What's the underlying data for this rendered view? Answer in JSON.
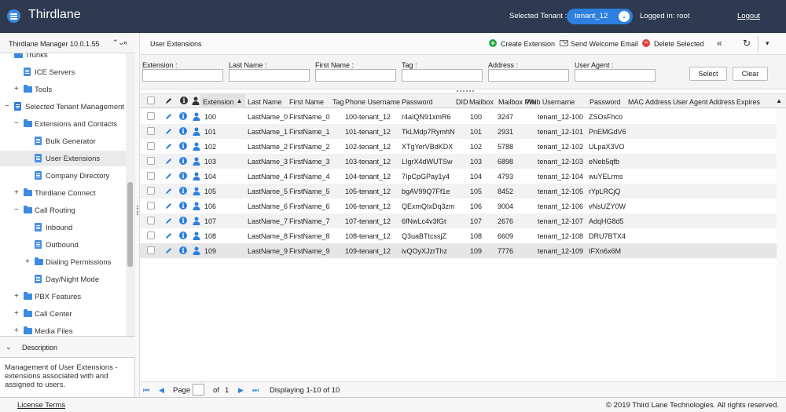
{
  "header": {
    "brand": "Thirdlane",
    "selected_tenant_label": "Selected Tenant :",
    "tenant_value": "tenant_12",
    "logged_in": "Logged in: root",
    "logout": "Logout"
  },
  "sidebar": {
    "title": "Thirdlane Manager 10.0.1.55",
    "tree": [
      {
        "label": "Trunks",
        "type": "folder",
        "indent": 0,
        "expander": ""
      },
      {
        "label": "ICE Servers",
        "type": "page",
        "indent": 1,
        "expander": ""
      },
      {
        "label": "Tools",
        "type": "folder",
        "indent": 1,
        "expander": "+"
      },
      {
        "label": "Selected Tenant Management",
        "type": "tenant",
        "indent": 0,
        "expander": "−"
      },
      {
        "label": "Extensions and Contacts",
        "type": "folder",
        "indent": 1,
        "expander": "−"
      },
      {
        "label": "Bulk Generator",
        "type": "page",
        "indent": 2,
        "expander": ""
      },
      {
        "label": "User Extensions",
        "type": "page",
        "indent": 2,
        "expander": "",
        "selected": true
      },
      {
        "label": "Company Directory",
        "type": "page",
        "indent": 2,
        "expander": ""
      },
      {
        "label": "Thirdlane Connect",
        "type": "folder",
        "indent": 1,
        "expander": "+"
      },
      {
        "label": "Call Routing",
        "type": "folder",
        "indent": 1,
        "expander": "−"
      },
      {
        "label": "Inbound",
        "type": "page",
        "indent": 2,
        "expander": ""
      },
      {
        "label": "Outbound",
        "type": "page",
        "indent": 2,
        "expander": ""
      },
      {
        "label": "Dialing Permissions",
        "type": "folder",
        "indent": 2,
        "expander": "+"
      },
      {
        "label": "Day/Night Mode",
        "type": "page",
        "indent": 2,
        "expander": ""
      },
      {
        "label": "PBX Features",
        "type": "folder",
        "indent": 1,
        "expander": "+"
      },
      {
        "label": "Call Center",
        "type": "folder",
        "indent": 1,
        "expander": "+"
      },
      {
        "label": "Media Files",
        "type": "folder",
        "indent": 1,
        "expander": "+"
      }
    ],
    "scroll_position": 0.65,
    "description_title": "Description",
    "description_text": "Management of User Extensions - extensions associated with and assigned to users."
  },
  "toolbar": {
    "title": "User Extensions",
    "create": "Create Extension",
    "send": "Send Welcome Email",
    "delete": "Delete Selected",
    "collapse_icon": "«",
    "refresh_icon": "↻",
    "menu_icon": "▾"
  },
  "filter": {
    "extension": "Extension :",
    "last_name": "Last Name :",
    "first_name": "First Name :",
    "tag": "Tag :",
    "address": "Address :",
    "user_agent": "User Agent :",
    "select": "Select",
    "clear": "Clear"
  },
  "grid": {
    "columns": [
      "Extension",
      "Last Name",
      "First Name",
      "Tag",
      "Phone Username",
      "Password",
      "DID",
      "Mailbox",
      "Mailbox PIN",
      "Web Username",
      "Password",
      "MAC Address",
      "User Agent",
      "Address",
      "Expires"
    ],
    "rows": [
      [
        "100",
        "LastName_0",
        "FirstName_0",
        "",
        "100-tenant_12",
        "r4aIQN91xmR6",
        "",
        "100",
        "3247",
        "tenant_12-100",
        "ZSOsFhco"
      ],
      [
        "101",
        "LastName_1",
        "FirstName_1",
        "",
        "101-tenant_12",
        "TkLMdp7RymhN",
        "",
        "101",
        "2931",
        "tenant_12-101",
        "PnEMGdV6"
      ],
      [
        "102",
        "LastName_2",
        "FirstName_2",
        "",
        "102-tenant_12",
        "XTgYerVBdKDX",
        "",
        "102",
        "5788",
        "tenant_12-102",
        "ULpaX3VO"
      ],
      [
        "103",
        "LastName_3",
        "FirstName_3",
        "",
        "103-tenant_12",
        "LIgrX4dWUTSw",
        "",
        "103",
        "6898",
        "tenant_12-103",
        "eNeb5qfb"
      ],
      [
        "104",
        "LastName_4",
        "FirstName_4",
        "",
        "104-tenant_12",
        "7IpCpGPay1y4",
        "",
        "104",
        "4793",
        "tenant_12-104",
        "wuYELrms"
      ],
      [
        "105",
        "LastName_5",
        "FirstName_5",
        "",
        "105-tenant_12",
        "bgAV99Q7Ff1e",
        "",
        "105",
        "8452",
        "tenant_12-105",
        "rYpLRCjQ"
      ],
      [
        "106",
        "LastName_6",
        "FirstName_6",
        "",
        "106-tenant_12",
        "QExmQIxDq3zm",
        "",
        "106",
        "9004",
        "tenant_12-106",
        "vNsUZY0W"
      ],
      [
        "107",
        "LastName_7",
        "FirstName_7",
        "",
        "107-tenant_12",
        "6fNwLc4v3fGt",
        "",
        "107",
        "2676",
        "tenant_12-107",
        "AdqHG8d5"
      ],
      [
        "108",
        "LastName_8",
        "FirstName_8",
        "",
        "108-tenant_12",
        "Q3uaBTtcssjZ",
        "",
        "108",
        "6609",
        "tenant_12-108",
        "DRU7BTX4"
      ],
      [
        "109",
        "LastName_9",
        "FirstName_9",
        "",
        "109-tenant_12",
        "ivQOyXJzrThz",
        "",
        "109",
        "7776",
        "tenant_12-109",
        "IFXn6x6M"
      ]
    ]
  },
  "pager": {
    "page_label": "Page",
    "of_label": "of",
    "total_pages": "1",
    "display": "Displaying 1-10 of 10"
  },
  "footer": {
    "license": "License Terms",
    "copyright": "© 2019 Third Lane Technologies. All rights reserved."
  },
  "colors": {
    "header_bg": "#2d3a4f",
    "accent_blue": "#2d7fe0",
    "create_green": "#2aa84a",
    "delete_red": "#e0463a"
  }
}
